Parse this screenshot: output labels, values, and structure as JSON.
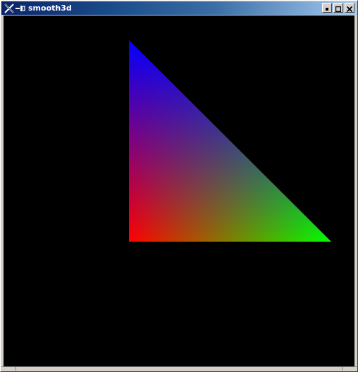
{
  "window": {
    "title": "smooth3d",
    "wm_icon": "x-logo-icon",
    "system_icon": "window-menu-icon",
    "buttons": [
      "minimize-icon",
      "maximize-icon",
      "close-icon"
    ]
  },
  "scene": {
    "background": "#000000",
    "triangle_vertex_colors": {
      "top": "#0000ff",
      "bottom_left": "#ff0000",
      "bottom_right": "#00ff00"
    }
  }
}
